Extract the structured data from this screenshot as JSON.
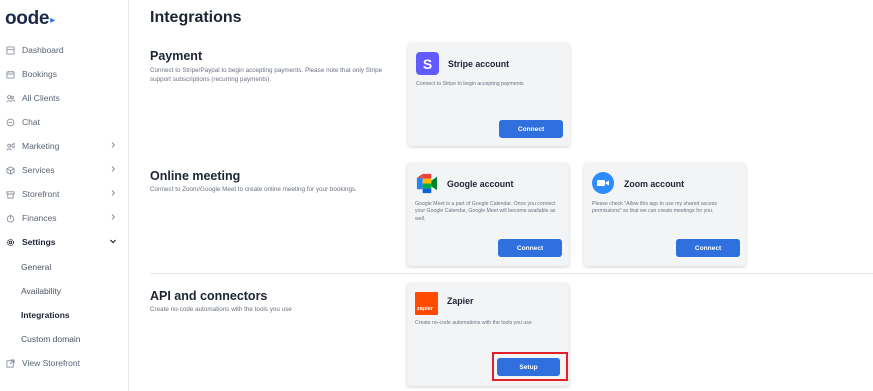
{
  "brand": {
    "logo_text": "oode",
    "logo_mark": "▸"
  },
  "sidebar": {
    "items": [
      {
        "label": "Dashboard",
        "icon": "dashboard-icon"
      },
      {
        "label": "Bookings",
        "icon": "calendar-icon"
      },
      {
        "label": "All Clients",
        "icon": "clients-icon"
      },
      {
        "label": "Chat",
        "icon": "chat-icon"
      },
      {
        "label": "Marketing",
        "icon": "marketing-icon"
      },
      {
        "label": "Services",
        "icon": "services-icon"
      },
      {
        "label": "Storefront",
        "icon": "storefront-icon"
      },
      {
        "label": "Finances",
        "icon": "finances-icon"
      },
      {
        "label": "Settings",
        "icon": "gear-icon"
      }
    ],
    "settings_sub": [
      {
        "label": "General"
      },
      {
        "label": "Availability"
      },
      {
        "label": "Integrations"
      },
      {
        "label": "Custom domain"
      }
    ],
    "view_storefront": "View Storefront"
  },
  "page": {
    "title": "Integrations"
  },
  "sections": {
    "payment": {
      "title": "Payment",
      "description": "Connect to Stripe/Paypal to begin accepting payments. Please note that only Stripe support subscriptions (recurring payments).",
      "stripe": {
        "title": "Stripe account",
        "logo_letter": "S",
        "description": "Connect to Stripe to begin accepting payments",
        "button": "Connect"
      }
    },
    "online_meeting": {
      "title": "Online meeting",
      "description": "Connect to Zoom/Google Meet to create online meeting for your bookings.",
      "google": {
        "title": "Google account",
        "description": "Google Meet is a part of Google Calendar. Once you connect your Google Calendar, Google Meet will become available as well.",
        "button": "Connect"
      },
      "zoom": {
        "title": "Zoom account",
        "description": "Please check \"Allow this app to use my shared access permissions\" so that we can create meetings for you.",
        "button": "Connect"
      }
    },
    "api": {
      "title": "API and connectors",
      "description": "Create no-code automations with the tools you use",
      "zapier": {
        "title": "Zapier",
        "logo_text": "zapier",
        "description": "Create no-code automations with the tools you use",
        "button": "Setup"
      }
    }
  },
  "colors": {
    "accent": "#2f6fde",
    "stripe": "#635bff",
    "zapier": "#ff4a00",
    "zoom": "#2d8cff",
    "highlight": "#e0202a"
  }
}
